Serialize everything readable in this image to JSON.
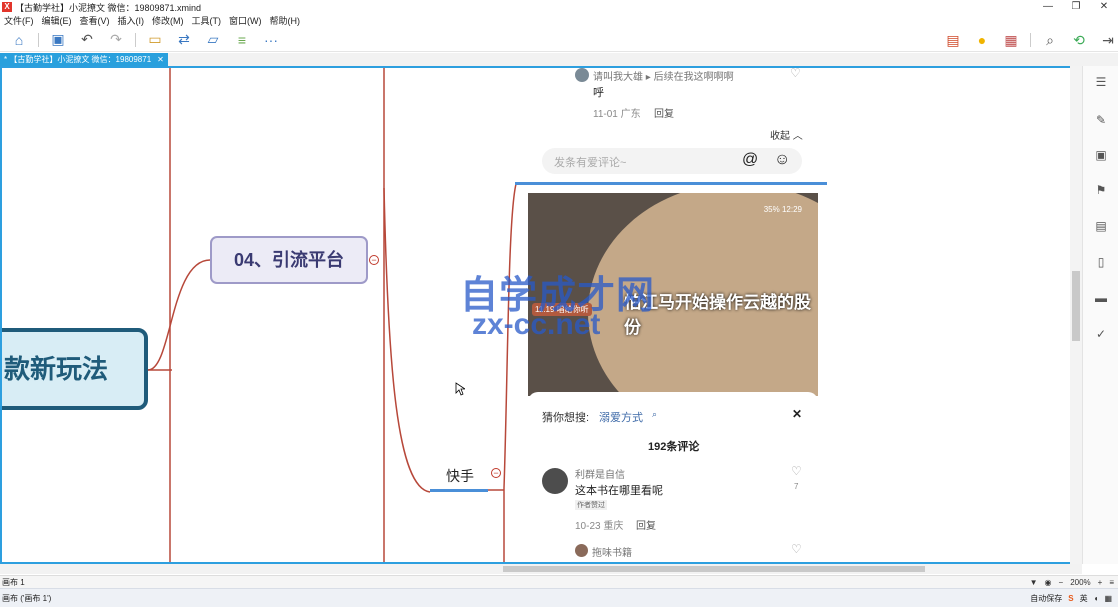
{
  "window": {
    "title": "【古勤学社】小泥撩文  微信：19809871.xmind",
    "logo": "X",
    "minimize": "—",
    "maximize": "❐",
    "close": "✕"
  },
  "menu": [
    "文件(F)",
    "编辑(E)",
    "查看(V)",
    "插入(I)",
    "修改(M)",
    "工具(T)",
    "窗口(W)",
    "帮助(H)"
  ],
  "toolbar": {
    "icons": [
      "home-icon",
      "save-icon",
      "undo-icon",
      "redo-icon",
      "topic-icon",
      "relationship-icon",
      "boundary-icon",
      "summary-icon",
      "more-icon"
    ],
    "more_label": "···",
    "right_icons": [
      "presentation-icon",
      "idea-icon",
      "layout-icon",
      "search-icon",
      "share-icon",
      "export-icon"
    ]
  },
  "tab": {
    "label": "* 【古勤学社】小泥撩文  微信：19809871",
    "close": "✕"
  },
  "mindmap": {
    "main_node": "款新玩法",
    "sub_node": "04、引流平台",
    "leaf_node": "快手",
    "collapse_symbol": "−"
  },
  "comment_top": {
    "name": "请叫我大雄 ▸ 后续在我这啊啊啊",
    "text": "呼",
    "meta": "11-01 广东",
    "reply": "回复",
    "collapse": "收起 ︿"
  },
  "comment_input": {
    "placeholder": "发条有爱评论~",
    "at": "@",
    "emoji": "☺"
  },
  "video": {
    "caption": "怕江马开始操作云越的股份",
    "status": "35% 12:29",
    "tag": "11.19 唱给你听"
  },
  "watermark": {
    "line1": "自学成才网",
    "line2": "zx-cc.net"
  },
  "panel": {
    "guess_label": "猜你想搜:",
    "guess_value": "溺爱方式",
    "close": "✕",
    "count": "192条评论",
    "comments": [
      {
        "name": "利群是自信",
        "text": "这本书在哪里看呢",
        "badge": "作者赞过",
        "meta": "10-23 重庆",
        "reply": "回复",
        "likes": "7"
      },
      {
        "name": "拖味书籍",
        "text": "",
        "badge": "",
        "meta": "",
        "reply": "",
        "likes": ""
      }
    ]
  },
  "status": {
    "sheet": "画布 1",
    "zoom": "200%",
    "minus": "−",
    "plus": "+"
  },
  "taskbar": {
    "left": "画布 ('画布 1')",
    "right": "自动保存",
    "ime": "英"
  }
}
